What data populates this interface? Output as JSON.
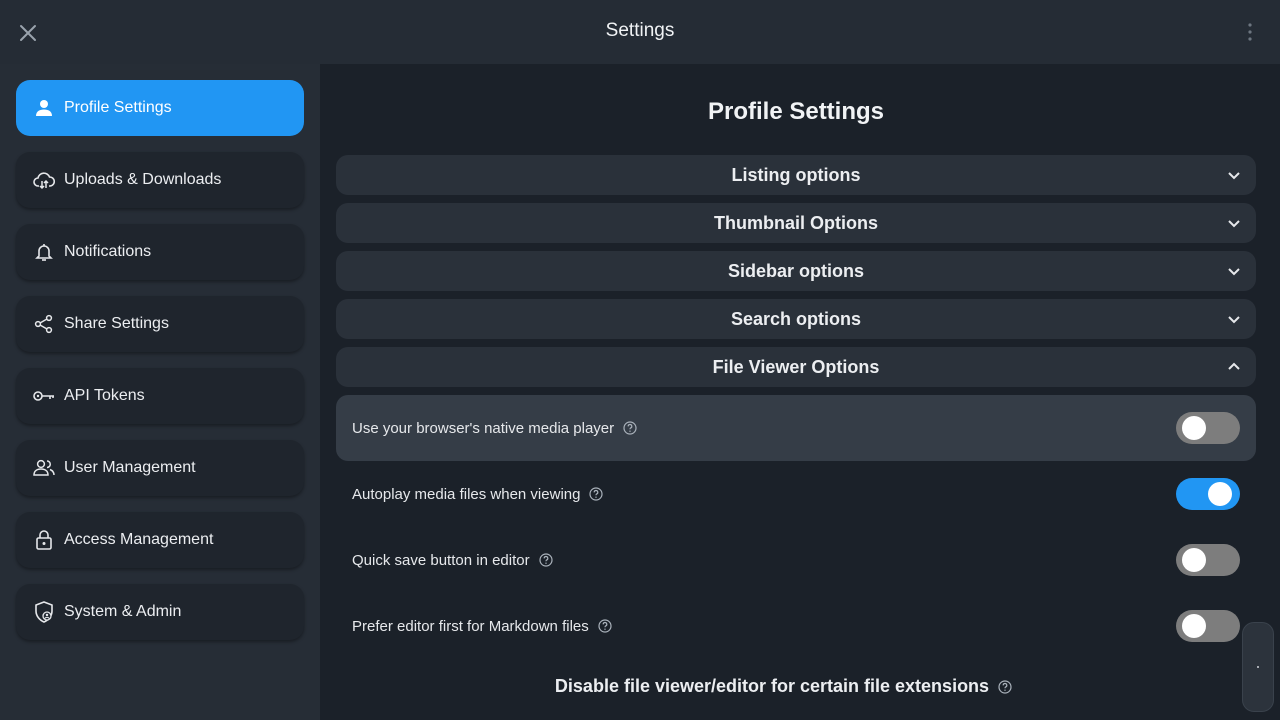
{
  "app": {
    "title": "Settings"
  },
  "colors": {
    "accent": "#2196f3",
    "topbar": "#252c35",
    "sidebar": "#262d36",
    "main": "#1b2129"
  },
  "sidebar": {
    "items": [
      {
        "label": "Profile Settings",
        "icon": "person-icon",
        "active": true
      },
      {
        "label": "Uploads & Downloads",
        "icon": "cloud-upload-download-icon"
      },
      {
        "label": "Notifications",
        "icon": "bell-icon"
      },
      {
        "label": "Share Settings",
        "icon": "share-icon"
      },
      {
        "label": "API Tokens",
        "icon": "key-icon"
      },
      {
        "label": "User Management",
        "icon": "users-icon"
      },
      {
        "label": "Access Management",
        "icon": "lock-icon"
      },
      {
        "label": "System & Admin",
        "icon": "shield-admin-icon"
      }
    ]
  },
  "main": {
    "heading": "Profile Settings",
    "sections": [
      {
        "label": "Listing options",
        "expanded": false
      },
      {
        "label": "Thumbnail Options",
        "expanded": false
      },
      {
        "label": "Sidebar options",
        "expanded": false
      },
      {
        "label": "Search options",
        "expanded": false
      },
      {
        "label": "File Viewer Options",
        "expanded": true
      }
    ],
    "file_viewer_options": [
      {
        "label": "Use your browser's native media player",
        "enabled": false,
        "highlighted": true
      },
      {
        "label": "Autoplay media files when viewing",
        "enabled": true
      },
      {
        "label": "Quick save button in editor",
        "enabled": false
      },
      {
        "label": "Prefer editor first for Markdown files",
        "enabled": false
      }
    ],
    "sub_heading": "Disable file viewer/editor for certain file extensions"
  }
}
